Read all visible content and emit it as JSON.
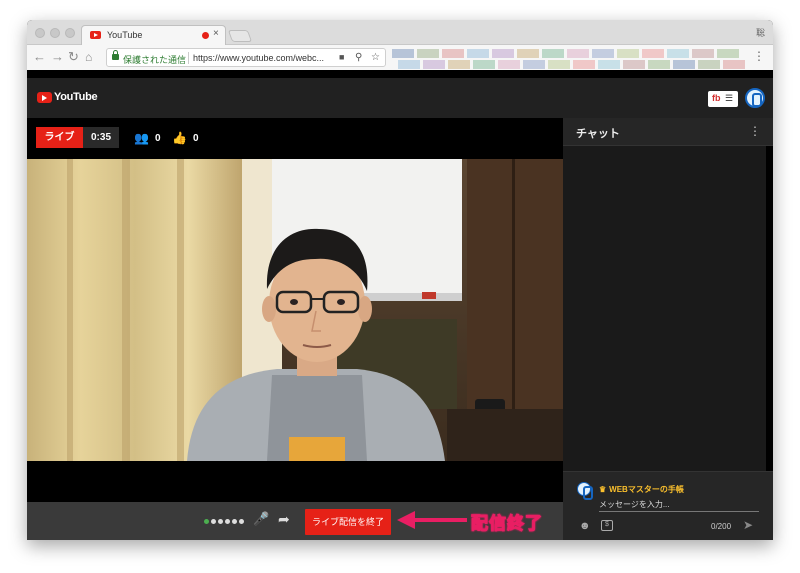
{
  "browser": {
    "tab_title": "YouTube",
    "tab_close": "×",
    "profile": "聡",
    "secure_label": "保護された通信",
    "url": "https://www.youtube.com/webc...",
    "bookmark_colors": [
      "#b7c4d8",
      "#c9d3c0",
      "#e8c4c4",
      "#c6d9e8",
      "#d8c9e0",
      "#e0d2b8",
      "#bcd8c8",
      "#e8d0dc",
      "#c4cde0",
      "#d8e0c4",
      "#f0c8c8",
      "#c8e0e8",
      "#dcc8c8",
      "#c8d8c0"
    ]
  },
  "youtube": {
    "logo_text": "YouTube",
    "fb_badge": "fb",
    "fb_menu": "☰"
  },
  "stats": {
    "live_label": "ライブ",
    "elapsed": "0:35",
    "viewers": "0",
    "likes": "0"
  },
  "controls": {
    "end_stream_label": "ライブ配信を終了",
    "annotation": "配信終了"
  },
  "chat": {
    "title": "チャット",
    "more": "⋮",
    "username": "WEBマスターの手帳",
    "placeholder": "メッセージを入力...",
    "char_count": "0/200",
    "money_icon": "$"
  },
  "colors": {
    "accent_red": "#e62117",
    "annotation_pink": "#e91e63",
    "chat_username": "#fbc02d"
  }
}
